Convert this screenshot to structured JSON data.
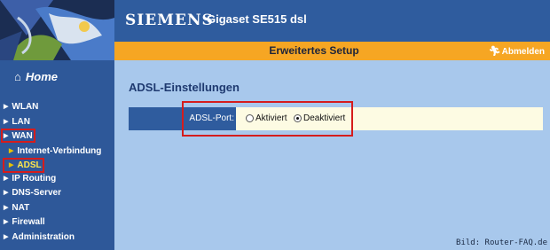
{
  "header": {
    "brand": "SIEMENS",
    "product": "Gigaset SE515 dsl"
  },
  "topbar": {
    "title": "Erweitertes Setup",
    "logout_label": "Abmelden",
    "logout_icon": "running-person-icon"
  },
  "sidebar": {
    "home_label": "Home",
    "home_icon": "house-icon",
    "items": [
      {
        "label": "WLAN",
        "level": 1,
        "highlighted": false
      },
      {
        "label": "LAN",
        "level": 1,
        "highlighted": false
      },
      {
        "label": "WAN",
        "level": 1,
        "highlighted": true
      },
      {
        "label": "Internet-Verbindung",
        "level": 2,
        "highlighted": false
      },
      {
        "label": "ADSL",
        "level": 2,
        "highlighted": true,
        "active": true
      },
      {
        "label": "IP Routing",
        "level": 1,
        "highlighted": false
      },
      {
        "label": "DNS-Server",
        "level": 1,
        "highlighted": false
      },
      {
        "label": "NAT",
        "level": 1,
        "highlighted": false
      },
      {
        "label": "Firewall",
        "level": 1,
        "highlighted": false
      },
      {
        "label": "Administration",
        "level": 1,
        "highlighted": false
      }
    ]
  },
  "main": {
    "title": "ADSL-Einstellungen",
    "port_label": "ADSL-Port:",
    "options": [
      {
        "label": "Aktiviert",
        "checked": false
      },
      {
        "label": "Deaktiviert",
        "checked": true
      }
    ]
  },
  "credit": "Bild: Router-FAQ.de",
  "colors": {
    "header_blue": "#2f5c9e",
    "orange": "#f6a623",
    "content_bg": "#a8c8ec",
    "highlight_red": "#d51c1c"
  }
}
